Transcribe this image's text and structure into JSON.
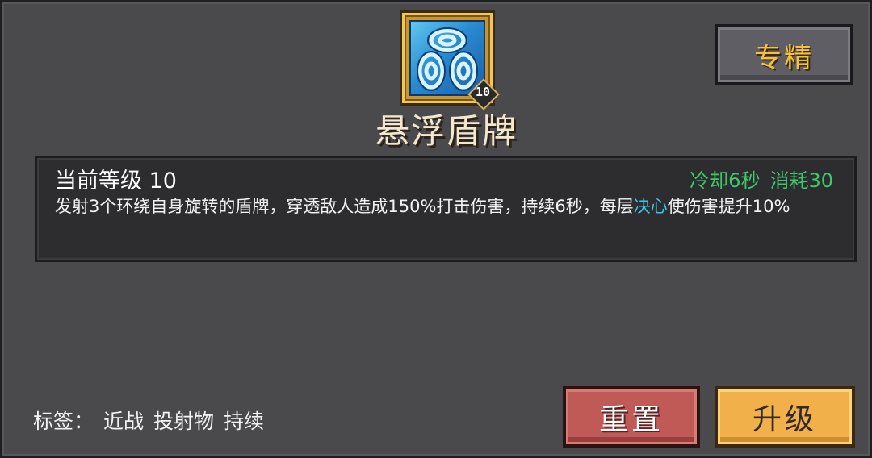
{
  "skill": {
    "name": "悬浮盾牌",
    "icon": "floating-shield-icon",
    "level_badge": "10"
  },
  "buttons": {
    "specialize": "专精",
    "reset": "重置",
    "upgrade": "升级"
  },
  "details": {
    "level_label": "当前等级 10",
    "cooldown": "冷却6秒",
    "cost": "消耗30",
    "description_before": "发射3个环绕自身旋转的盾牌，穿透敌人造成150%打击伤害，持续6秒，每层",
    "description_keyword": "决心",
    "description_after": "使伤害提升10%"
  },
  "tags": {
    "label": "标签：",
    "items": [
      "近战",
      "投射物",
      "持续"
    ]
  },
  "colors": {
    "stat_green": "#3fc86a",
    "keyword_cyan": "#3fc3e8",
    "specialize_text": "#f5c23a",
    "reset_red": "#c05a56",
    "upgrade_orange": "#f1b04a"
  }
}
